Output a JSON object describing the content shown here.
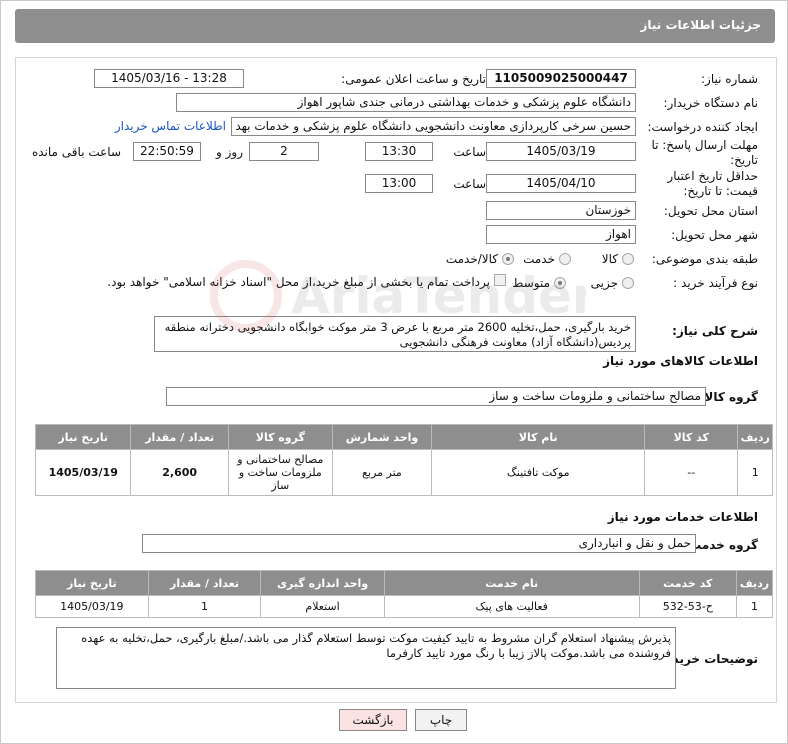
{
  "header": {
    "title": "جزئیات اطلاعات نیاز"
  },
  "form": {
    "need_number_label": "شماره نیاز:",
    "need_number": "1105009025000447",
    "announce_label": "تاریخ و ساعت اعلان عمومی:",
    "announce_value": "1405/03/16 - 13:28",
    "buyer_org_label": "نام دستگاه خریدار:",
    "buyer_org": "دانشگاه علوم پزشکی و خدمات بهداشتی درمانی جندی شاپور اهواز",
    "requester_label": "ایجاد کننده درخواست:",
    "requester": "حسین سرخی کارپردازی معاونت دانشجویی دانشگاه علوم پزشکی و خدمات بهد",
    "contact_link": "اطلاعات تماس خریدار",
    "reply_deadline_label": "مهلت ارسال پاسخ: تا تاریخ:",
    "reply_date": "1405/03/19",
    "time_label": "ساعت",
    "reply_time": "13:30",
    "days_value": "2",
    "days_label": "روز و",
    "remaining_time": "22:50:59",
    "remaining_label": "ساعت باقی مانده",
    "validity_label": "حداقل تاریخ اعتبار قیمت: تا تاریخ:",
    "validity_date": "1405/04/10",
    "validity_time": "13:00",
    "province_label": "استان محل تحویل:",
    "province": "خوزستان",
    "city_label": "شهر محل تحویل:",
    "city": "اهواز",
    "category_label": "طبقه بندی موضوعی:",
    "category_options": [
      "کالا",
      "خدمت",
      "کالا/خدمت"
    ],
    "process_label": "نوع فرآیند خرید :",
    "process_options": [
      "جزیی",
      "متوسط"
    ],
    "payment_note": "پرداخت تمام یا بخشی از مبلغ خرید،از محل \"اسناد خزانه اسلامی\" خواهد بود."
  },
  "description": {
    "label": "شرح کلی نیاز:",
    "text": "خرید بارگیری، حمل،تخلیه 2600 متر مربع با عرض 3 متر موکت خوابگاه دانشجویی دخترانه منطقه پردیس(دانشگاه آزاد) معاونت فرهنگی دانشجویی"
  },
  "goods": {
    "section_title": "اطلاعات کالاهای مورد نیاز",
    "group_label": "گروه کالا:",
    "group_value": "مصالح ساختمانی و ملزومات ساخت و ساز",
    "columns": [
      "ردیف",
      "کد کالا",
      "نام کالا",
      "واحد شمارش",
      "گروه کالا",
      "تعداد / مقدار",
      "تاریخ نیاز"
    ],
    "rows": [
      {
        "row": "1",
        "code": "--",
        "name": "موکت تافتینگ",
        "unit": "متر مربع",
        "group": "مصالح ساختمانی و ملزومات ساخت و ساز",
        "qty": "2,600",
        "date": "1405/03/19"
      }
    ]
  },
  "services": {
    "section_title": "اطلاعات خدمات مورد نیاز",
    "group_label": "گروه خدمت:",
    "group_value": "حمل و نقل و انبارداری",
    "columns": [
      "ردیف",
      "کد خدمت",
      "نام خدمت",
      "واحد اندازه گیری",
      "تعداد / مقدار",
      "تاریخ نیاز"
    ],
    "rows": [
      {
        "row": "1",
        "code": "ح-53-532",
        "name": "فعالیت های پیک",
        "unit": "استعلام",
        "qty": "1",
        "date": "1405/03/19"
      }
    ]
  },
  "buyer_notes": {
    "label": "توضیحات خریدار:",
    "text": "پذیرش پیشنهاد استعلام گران مشروط به تایید کیفیت موکت توسط استعلام گذار می باشد./مبلغ بارگیری، حمل،تخلیه  به عهده فروشنده می باشد.موکت پالاز زیبا با رنگ مورد تایید کارفرما"
  },
  "buttons": {
    "print": "چاپ",
    "back": "بازگشت"
  },
  "watermark_text": "AriaTender.neT"
}
